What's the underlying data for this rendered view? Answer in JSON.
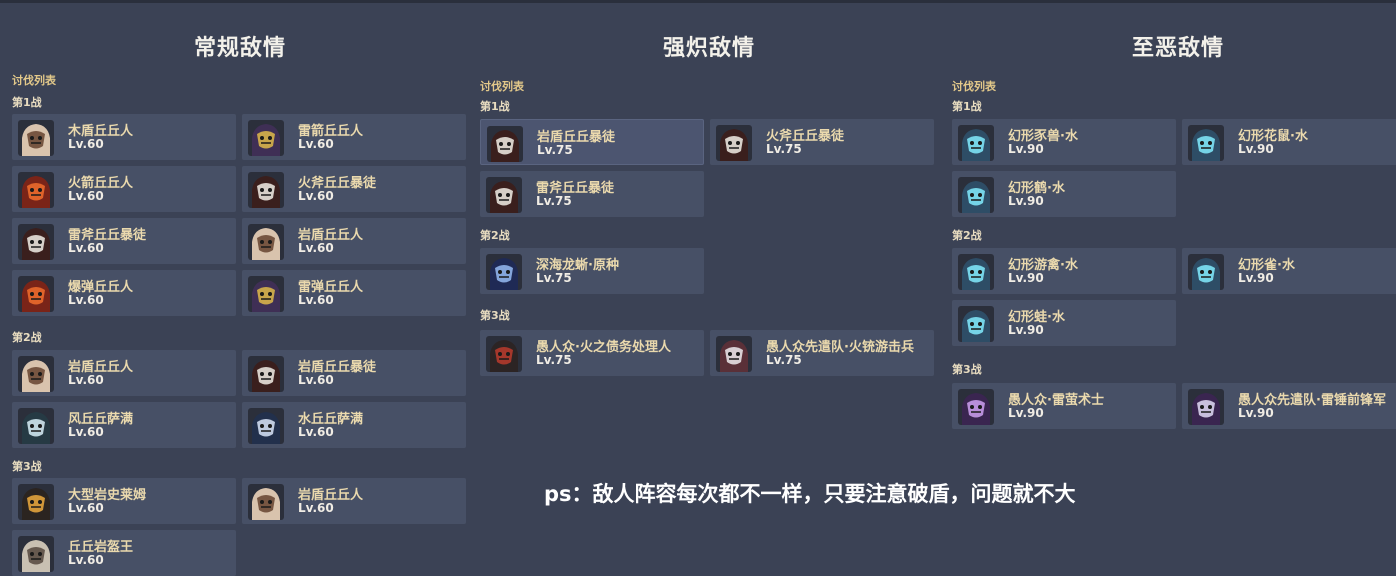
{
  "columns": [
    {
      "title": "常规敌情",
      "list_label": "讨伐列表",
      "battles": [
        {
          "label": "第1战",
          "enemies": [
            {
              "name": "木盾丘丘人",
              "level": "Lv.60",
              "icon": "hilichurl-wood-shield-icon",
              "tone": "#d9c3ad",
              "accent": "#6b4a36"
            },
            {
              "name": "雷箭丘丘人",
              "level": "Lv.60",
              "icon": "hilichurl-electro-archer-icon",
              "tone": "#3f2f55",
              "accent": "#d7b24a"
            },
            {
              "name": "火箭丘丘人",
              "level": "Lv.60",
              "icon": "hilichurl-pyro-archer-icon",
              "tone": "#7a2418",
              "accent": "#ea6a2c"
            },
            {
              "name": "火斧丘丘暴徒",
              "level": "Lv.60",
              "icon": "mitachurl-pyro-axe-icon",
              "tone": "#3a1f1d",
              "accent": "#e8e2dc"
            },
            {
              "name": "雷斧丘丘暴徒",
              "level": "Lv.60",
              "icon": "mitachurl-electro-axe-icon",
              "tone": "#3a1f1d",
              "accent": "#e8e2dc"
            },
            {
              "name": "岩盾丘丘人",
              "level": "Lv.60",
              "icon": "hilichurl-geo-shield-icon",
              "tone": "#d9c3ad",
              "accent": "#6b4a36"
            },
            {
              "name": "爆弹丘丘人",
              "level": "Lv.60",
              "icon": "hilichurl-grenadier-icon",
              "tone": "#7a2418",
              "accent": "#ea6a2c"
            },
            {
              "name": "雷弹丘丘人",
              "level": "Lv.60",
              "icon": "hilichurl-electro-grenadier-icon",
              "tone": "#3f2f55",
              "accent": "#d7b24a"
            }
          ]
        },
        {
          "label": "第2战",
          "enemies": [
            {
              "name": "岩盾丘丘人",
              "level": "Lv.60",
              "icon": "hilichurl-geo-shield-icon",
              "tone": "#d9c3ad",
              "accent": "#6b4a36"
            },
            {
              "name": "岩盾丘丘暴徒",
              "level": "Lv.60",
              "icon": "mitachurl-geo-shield-icon",
              "tone": "#3a1f1d",
              "accent": "#e8e2dc"
            },
            {
              "name": "风丘丘萨满",
              "level": "Lv.60",
              "icon": "samachurl-anemo-icon",
              "tone": "#263a44",
              "accent": "#cfe6ee"
            },
            {
              "name": "水丘丘萨满",
              "level": "Lv.60",
              "icon": "samachurl-hydro-icon",
              "tone": "#22304c",
              "accent": "#cfdcf0"
            }
          ]
        },
        {
          "label": "第3战",
          "enemies": [
            {
              "name": "大型岩史莱姆",
              "level": "Lv.60",
              "icon": "large-geo-slime-icon",
              "tone": "#2b2420",
              "accent": "#e2a33c"
            },
            {
              "name": "岩盾丘丘人",
              "level": "Lv.60",
              "icon": "hilichurl-geo-shield-icon",
              "tone": "#d9c3ad",
              "accent": "#6b4a36"
            },
            {
              "name": "丘丘岩盔王",
              "level": "Lv.60",
              "icon": "geovishap-lawachurl-icon",
              "tone": "#c9c0b2",
              "accent": "#5b4e44"
            }
          ]
        }
      ]
    },
    {
      "title": "强炽敌情",
      "list_label": "讨伐列表",
      "battles": [
        {
          "label": "第1战",
          "enemies": [
            {
              "name": "岩盾丘丘暴徒",
              "level": "Lv.75",
              "icon": "mitachurl-geo-shield-icon",
              "tone": "#3a1f1d",
              "accent": "#e8e2dc"
            },
            {
              "name": "火斧丘丘暴徒",
              "level": "Lv.75",
              "icon": "mitachurl-pyro-axe-icon",
              "tone": "#3a1f1d",
              "accent": "#e8e2dc"
            },
            {
              "name": "雷斧丘丘暴徒",
              "level": "Lv.75",
              "icon": "mitachurl-electro-axe-icon",
              "tone": "#3a1f1d",
              "accent": "#e8e2dc"
            }
          ]
        },
        {
          "label": "第2战",
          "enemies": [
            {
              "name": "深海龙蜥·原种",
              "level": "Lv.75",
              "icon": "bathysmal-vishap-icon",
              "tone": "#1f2a55",
              "accent": "#8fb2ea"
            }
          ]
        },
        {
          "label": "第3战",
          "enemies": [
            {
              "name": "愚人众·火之债务处理人",
              "level": "Lv.75",
              "icon": "fatui-pyro-agent-icon",
              "tone": "#2c2424",
              "accent": "#b23a2c"
            },
            {
              "name": "愚人众先遣队·火铳游击兵",
              "level": "Lv.75",
              "icon": "fatui-pyro-gunner-icon",
              "tone": "#5a3038",
              "accent": "#e6e1e4"
            }
          ]
        }
      ]
    },
    {
      "title": "至恶敌情",
      "list_label": "讨伐列表",
      "battles": [
        {
          "label": "第1战",
          "enemies": [
            {
              "name": "幻形豕兽·水",
              "level": "Lv.90",
              "icon": "hydro-mimic-boar-icon",
              "tone": "#2e4d66",
              "accent": "#7de3f5"
            },
            {
              "name": "幻形花鼠·水",
              "level": "Lv.90",
              "icon": "hydro-mimic-squirrel-icon",
              "tone": "#2e4d66",
              "accent": "#7de3f5"
            },
            {
              "name": "幻形鹤·水",
              "level": "Lv.90",
              "icon": "hydro-mimic-crane-icon",
              "tone": "#2e4d66",
              "accent": "#7de3f5"
            }
          ]
        },
        {
          "label": "第2战",
          "enemies": [
            {
              "name": "幻形游禽·水",
              "level": "Lv.90",
              "icon": "hydro-mimic-mallard-icon",
              "tone": "#2e4d66",
              "accent": "#7de3f5"
            },
            {
              "name": "幻形雀·水",
              "level": "Lv.90",
              "icon": "hydro-mimic-finch-icon",
              "tone": "#2e4d66",
              "accent": "#7de3f5"
            },
            {
              "name": "幻形蛙·水",
              "level": "Lv.90",
              "icon": "hydro-mimic-frog-icon",
              "tone": "#2e4d66",
              "accent": "#7de3f5"
            }
          ]
        },
        {
          "label": "第3战",
          "enemies": [
            {
              "name": "愚人众·雷萤术士",
              "level": "Lv.90",
              "icon": "fatui-electro-cicin-mage-icon",
              "tone": "#3a2550",
              "accent": "#c79ae8"
            },
            {
              "name": "愚人众先遣队·雷锤前锋军",
              "level": "Lv.90",
              "icon": "fatui-electrohammer-vanguard-icon",
              "tone": "#3a2550",
              "accent": "#d9d2ec"
            }
          ]
        }
      ]
    }
  ],
  "footnote": "ps：敌人阵容每次都不一样，只要注意破盾，问题就不大"
}
